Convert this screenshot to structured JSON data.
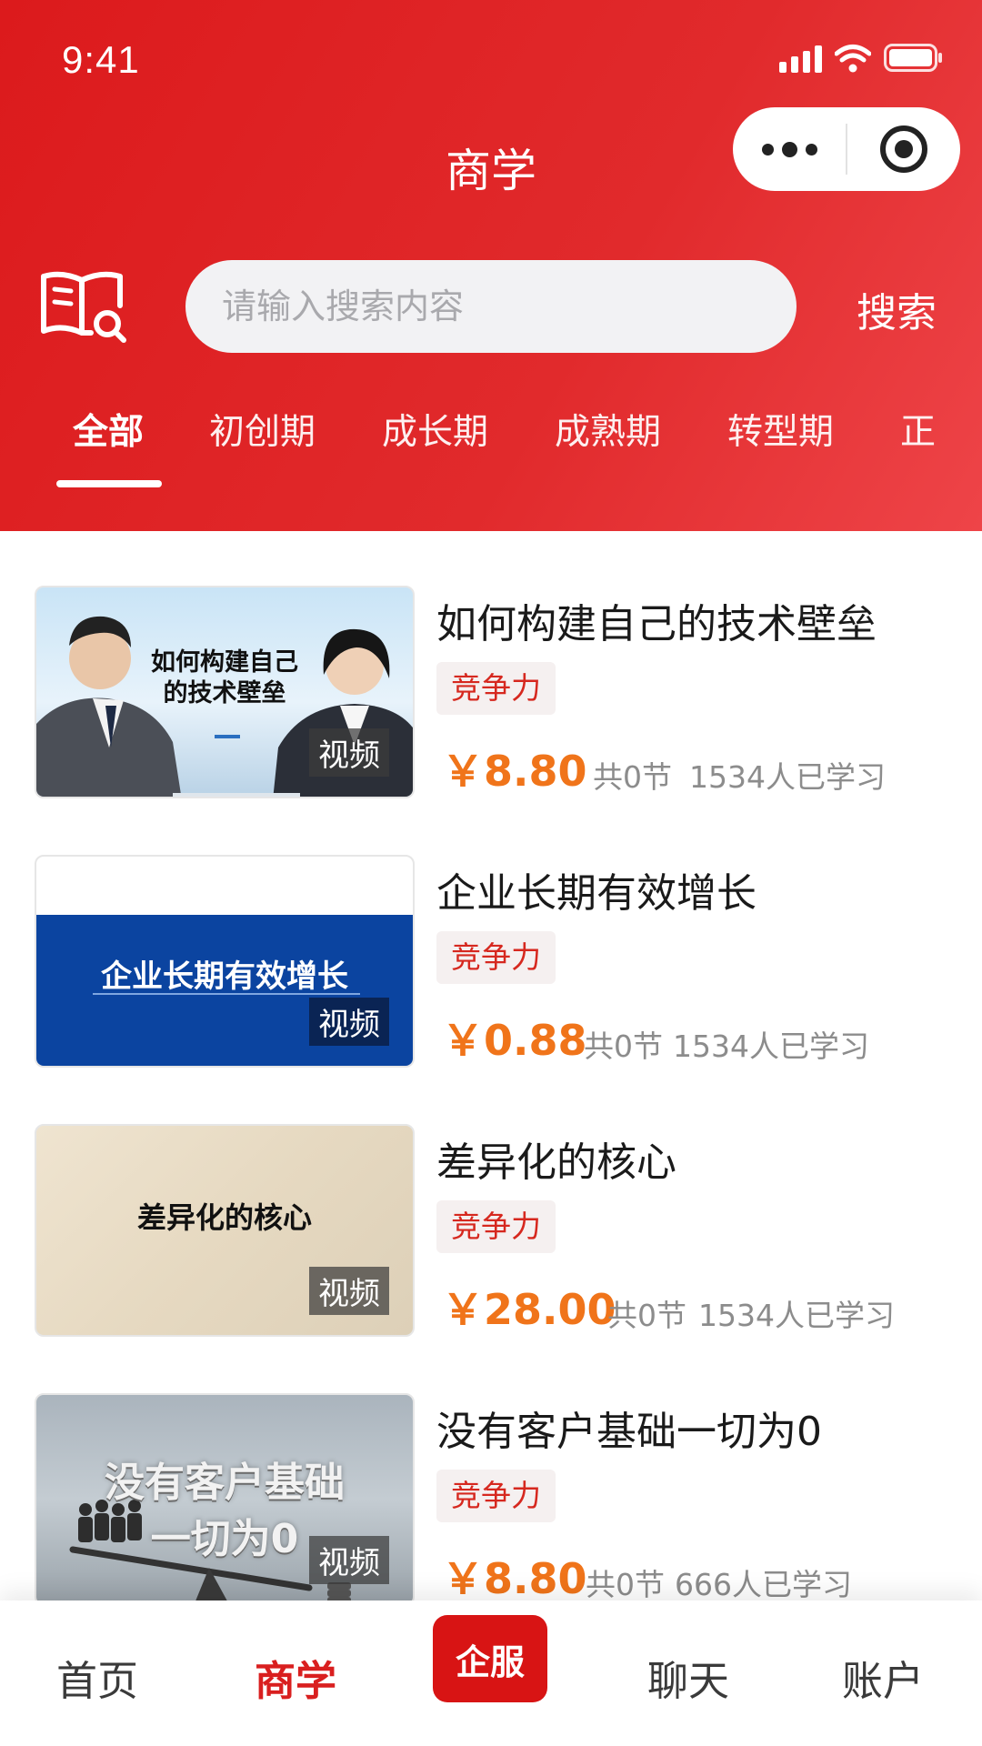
{
  "status_bar": {
    "time": "9:41"
  },
  "nav": {
    "title": "商学"
  },
  "search": {
    "placeholder": "请输入搜索内容",
    "button_label": "搜索"
  },
  "categories": [
    {
      "label": "全部",
      "active": true
    },
    {
      "label": "初创期"
    },
    {
      "label": "成长期"
    },
    {
      "label": "成熟期"
    },
    {
      "label": "转型期"
    },
    {
      "label": "正"
    }
  ],
  "courses": [
    {
      "thumb_text": "如何构建自己\n的技术壁垒",
      "badge": "视频",
      "title": "如何构建自己的技术壁垒",
      "tag": "竞争力",
      "price": "￥8.80",
      "sections": "共0节",
      "learners": "1534人已学习"
    },
    {
      "thumb_text": "企业长期有效增长",
      "badge": "视频",
      "title": "企业长期有效增长",
      "tag": "竞争力",
      "price": "￥0.88",
      "sections": "共0节",
      "learners": "1534人已学习"
    },
    {
      "thumb_text": "差异化的核心",
      "badge": "视频",
      "title": "差异化的核心",
      "tag": "竞争力",
      "price": "￥28.00",
      "sections": "共0节",
      "learners": "1534人已学习"
    },
    {
      "thumb_text": "没有客户基础\n一切为0",
      "badge": "视频",
      "title": "没有客户基础一切为0",
      "tag": "竞争力",
      "price": "￥8.80",
      "sections": "共0节",
      "learners": "666人已学习"
    }
  ],
  "tabbar": {
    "home": "首页",
    "business": "商学",
    "enterprise": "企服",
    "chat": "聊天",
    "account": "账户"
  },
  "colors": {
    "brand_red": "#dc1a1c",
    "price_orange": "#f0741a",
    "tag_red": "#d6281f"
  }
}
